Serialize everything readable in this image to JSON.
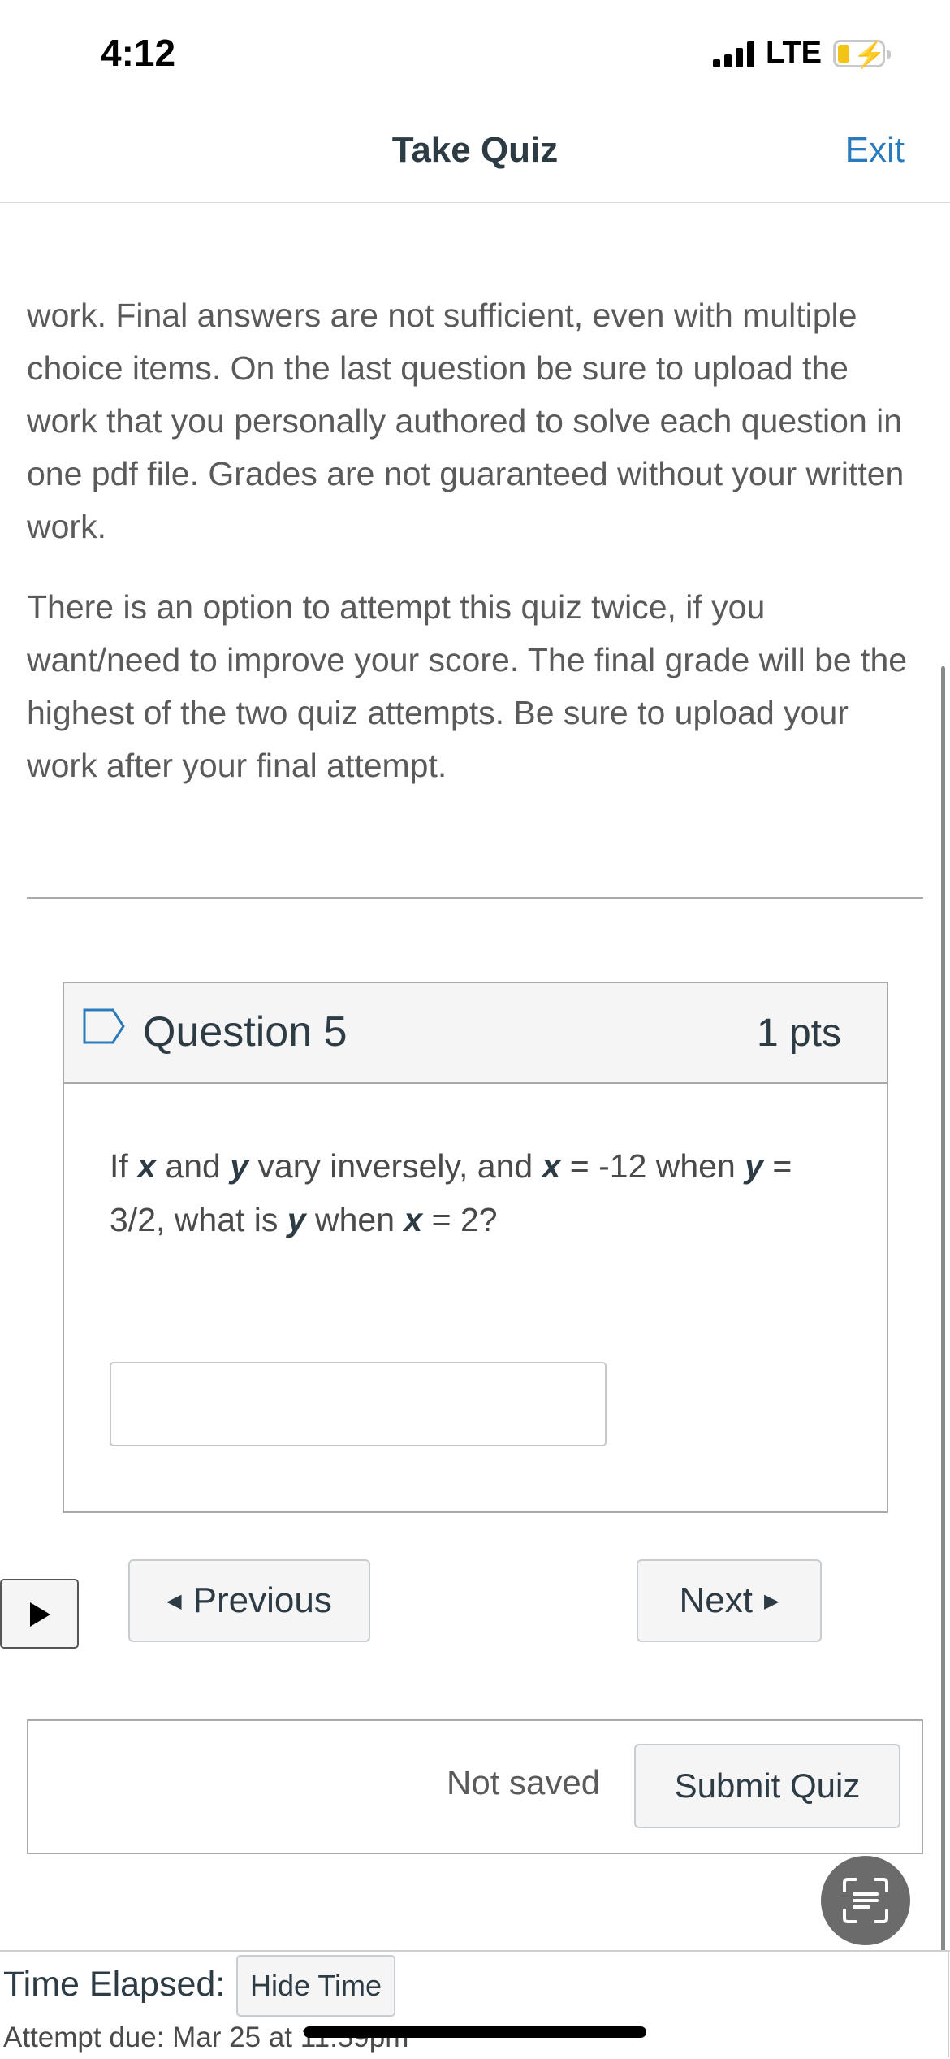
{
  "status_bar": {
    "time": "4:12",
    "network": "LTE"
  },
  "header": {
    "title": "Take Quiz",
    "exit_label": "Exit"
  },
  "instructions": {
    "paragraph_1": "work.  Final answers are not sufficient, even with multiple choice items.  On the last question be sure to upload the work that you personally authored to solve each question in one pdf file.  Grades are not guaranteed without your written work.",
    "paragraph_2": "There is an option to attempt this quiz twice, if you want/need to improve your score.  The final grade will be the highest of the two quiz attempts.  Be sure to upload your work after your final attempt."
  },
  "question": {
    "title": "Question 5",
    "points": "1 pts",
    "text_parts": [
      "If ",
      "x",
      " and ",
      "y",
      " vary inversely, and ",
      "x",
      " = -12 when ",
      "y",
      " = 3/2, what is ",
      "y",
      " when ",
      "x",
      " = 2?"
    ],
    "answer_value": ""
  },
  "navigation": {
    "previous_label": "Previous",
    "next_label": "Next"
  },
  "submit": {
    "status": "Not saved",
    "submit_label": "Submit Quiz"
  },
  "timer": {
    "label": "Time Elapsed:",
    "hide_label": "Hide Time",
    "due_text": "Attempt due: Mar 25 at 11:59pm"
  },
  "colors": {
    "accent_link": "#2b7abc",
    "text_primary": "#2d3b45",
    "battery_fill": "#f3c316"
  },
  "icons": {
    "status": [
      "signal-icon",
      "battery-charging-icon"
    ],
    "question_flag": "flag-icon",
    "media": "play-icon",
    "scan": "scan-text-icon"
  }
}
